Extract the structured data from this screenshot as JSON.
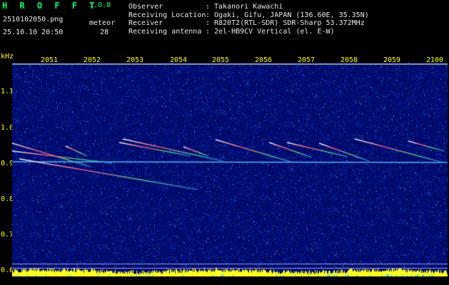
{
  "app": {
    "name": "H R O F F T",
    "version": "1.0.0"
  },
  "capture": {
    "filename": "2510102050.png",
    "datetime": "25.10.10 20:50"
  },
  "counter": {
    "label": "meteor",
    "value": "28"
  },
  "info": [
    {
      "key": "Observer",
      "value": "Takanori Kawachi"
    },
    {
      "key": "Receiving Location",
      "value": "Ogaki, Gifu, JAPAN (136.60E, 35.35N)"
    },
    {
      "key": "Receiver",
      "value": "R820T2(RTL-SDR) SDR-Sharp 53.372MHz"
    },
    {
      "key": "Receiving antenna",
      "value": "2el-HB9CV Vertical (el. E-W)"
    }
  ],
  "separator": ":",
  "axis": {
    "unit": "kHz",
    "y_ticks": [
      "1.1",
      "1.0",
      "0.9",
      "0.8",
      "0.7",
      "0.6"
    ],
    "x_ticks": [
      "2051",
      "2052",
      "2053",
      "2054",
      "2055",
      "2056",
      "2057",
      "2058",
      "2059",
      "2100"
    ]
  },
  "colors": {
    "background": "#000000",
    "label": "#ffff00",
    "title": "#00ff6a",
    "spectrum_bg": "#000c8a",
    "level_bar": "#ffff20"
  }
}
